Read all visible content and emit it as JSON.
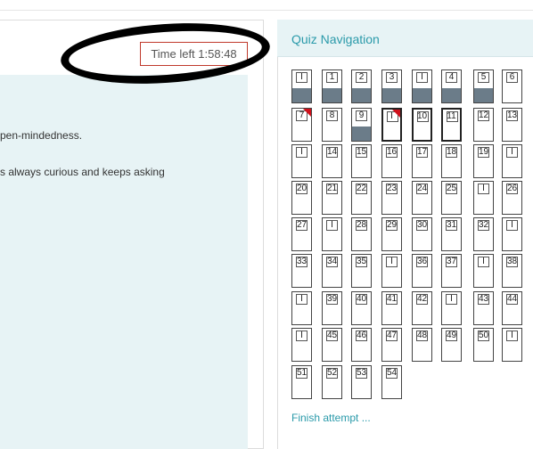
{
  "timer": {
    "label": "Time left 1:58:48"
  },
  "question": {
    "line1": "pen-mindedness.",
    "line2": "s always curious and keeps asking"
  },
  "quiz_nav": {
    "title": "Quiz Navigation",
    "finish_label": "Finish attempt ...",
    "rows": [
      [
        {
          "label": "I",
          "answered": true
        },
        {
          "label": "1",
          "answered": true
        },
        {
          "label": "2",
          "answered": true
        },
        {
          "label": "3",
          "answered": true
        },
        {
          "label": "I",
          "answered": true
        },
        {
          "label": "4",
          "answered": true
        },
        {
          "label": "5",
          "answered": true
        },
        {
          "label": "6"
        }
      ],
      [
        {
          "label": "7",
          "flagged": true
        },
        {
          "label": "8"
        },
        {
          "label": "9",
          "answered": true
        },
        {
          "label": "I",
          "flagged": true,
          "current": true
        },
        {
          "label": "10",
          "current": true
        },
        {
          "label": "11",
          "current": true
        },
        {
          "label": "12"
        },
        {
          "label": "13"
        }
      ],
      [
        {
          "label": "I"
        },
        {
          "label": "14"
        },
        {
          "label": "15"
        },
        {
          "label": "16"
        },
        {
          "label": "17"
        },
        {
          "label": "18"
        },
        {
          "label": "19"
        },
        {
          "label": "I"
        }
      ],
      [
        {
          "label": "20"
        },
        {
          "label": "21"
        },
        {
          "label": "22"
        },
        {
          "label": "23"
        },
        {
          "label": "24"
        },
        {
          "label": "25"
        },
        {
          "label": "I"
        },
        {
          "label": "26"
        }
      ],
      [
        {
          "label": "27"
        },
        {
          "label": "I"
        },
        {
          "label": "28"
        },
        {
          "label": "29"
        },
        {
          "label": "30"
        },
        {
          "label": "31"
        },
        {
          "label": "32"
        },
        {
          "label": "I"
        }
      ],
      [
        {
          "label": "33"
        },
        {
          "label": "34"
        },
        {
          "label": "35"
        },
        {
          "label": "I"
        },
        {
          "label": "36"
        },
        {
          "label": "37"
        },
        {
          "label": "I"
        },
        {
          "label": "38"
        }
      ],
      [
        {
          "label": "I"
        },
        {
          "label": "39"
        },
        {
          "label": "40"
        },
        {
          "label": "41"
        },
        {
          "label": "42"
        },
        {
          "label": "I"
        },
        {
          "label": "43"
        },
        {
          "label": "44"
        }
      ],
      [
        {
          "label": "I"
        },
        {
          "label": "45"
        },
        {
          "label": "46"
        },
        {
          "label": "47"
        },
        {
          "label": "48"
        },
        {
          "label": "49"
        },
        {
          "label": "50"
        },
        {
          "label": "I"
        }
      ],
      [
        {
          "label": "51"
        },
        {
          "label": "52"
        },
        {
          "label": "53"
        },
        {
          "label": "54"
        }
      ]
    ]
  },
  "colors": {
    "accent": "#2a9aaa",
    "answered": "#6b7c89",
    "flag": "#d0101b",
    "timer_border": "#c0392b",
    "panel_bg": "#e7f3f5"
  }
}
